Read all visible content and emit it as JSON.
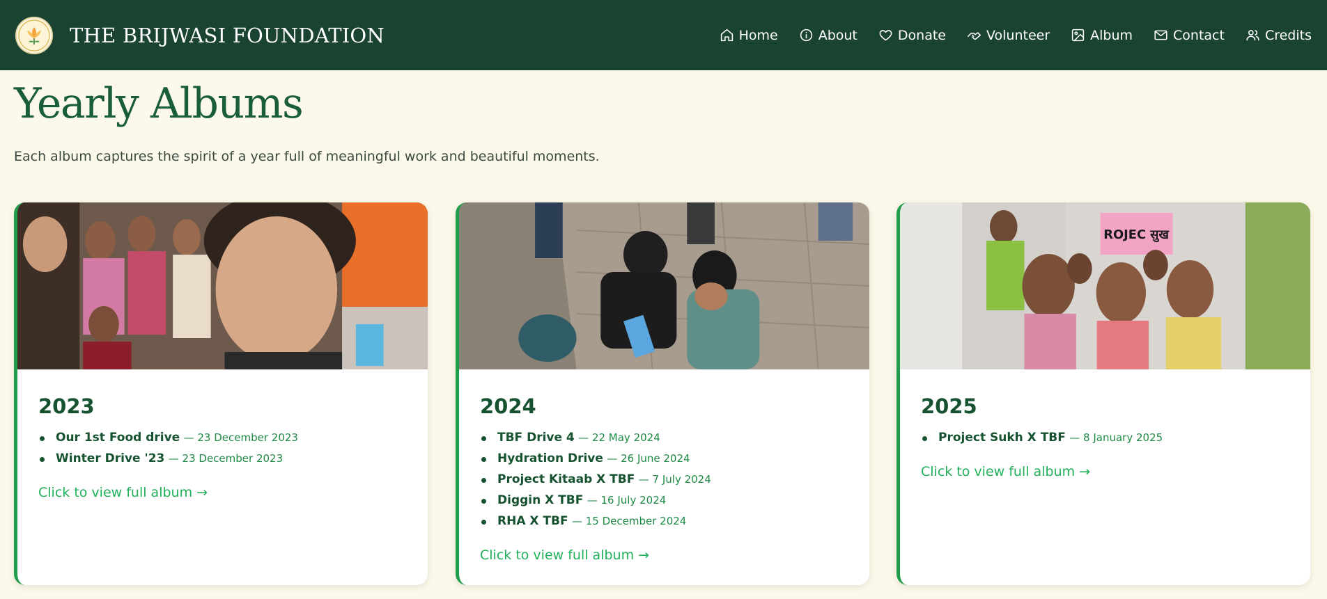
{
  "header": {
    "brand_name": "THE BRIJWASI FOUNDATION",
    "logo_text": "THE BRIJWASI FOUNDATION",
    "background_color": "#1b4332",
    "nav": [
      {
        "label": "Home",
        "icon": "home-icon"
      },
      {
        "label": "About",
        "icon": "info-icon"
      },
      {
        "label": "Donate",
        "icon": "heart-icon"
      },
      {
        "label": "Volunteer",
        "icon": "handshake-icon"
      },
      {
        "label": "Album",
        "icon": "image-icon"
      },
      {
        "label": "Contact",
        "icon": "mail-icon"
      },
      {
        "label": "Credits",
        "icon": "users-icon"
      }
    ]
  },
  "page": {
    "title": "Yearly Albums",
    "subtitle": "Each album captures the spirit of a year full of meaningful work and beautiful moments.",
    "accent_color": "#1f9d4a",
    "background_color": "#fdf9ea"
  },
  "albums": [
    {
      "year": "2023",
      "photo": "group-selfie-photo",
      "events": [
        {
          "name": "Our 1st Food drive",
          "date": "— 23 December 2023"
        },
        {
          "name": "Winter Drive '23",
          "date": "— 23 December 2023"
        }
      ],
      "link": "Click to view full album →"
    },
    {
      "year": "2024",
      "photo": "volunteers-kneeling-photo",
      "events": [
        {
          "name": "TBF Drive 4",
          "date": "— 22 May 2024"
        },
        {
          "name": "Hydration Drive",
          "date": "— 26 June 2024"
        },
        {
          "name": "Project Kitaab X TBF",
          "date": "— 7 July 2024"
        },
        {
          "name": "Diggin X TBF",
          "date": "— 16 July 2024"
        },
        {
          "name": "RHA X TBF",
          "date": "— 15 December 2024"
        }
      ],
      "link": "Click to view full album →"
    },
    {
      "year": "2025",
      "photo": "children-peace-sign-photo",
      "sign_text": "ROJEC सुख",
      "events": [
        {
          "name": "Project Sukh X TBF",
          "date": "— 8 January 2025"
        }
      ],
      "link": "Click to view full album →"
    }
  ]
}
